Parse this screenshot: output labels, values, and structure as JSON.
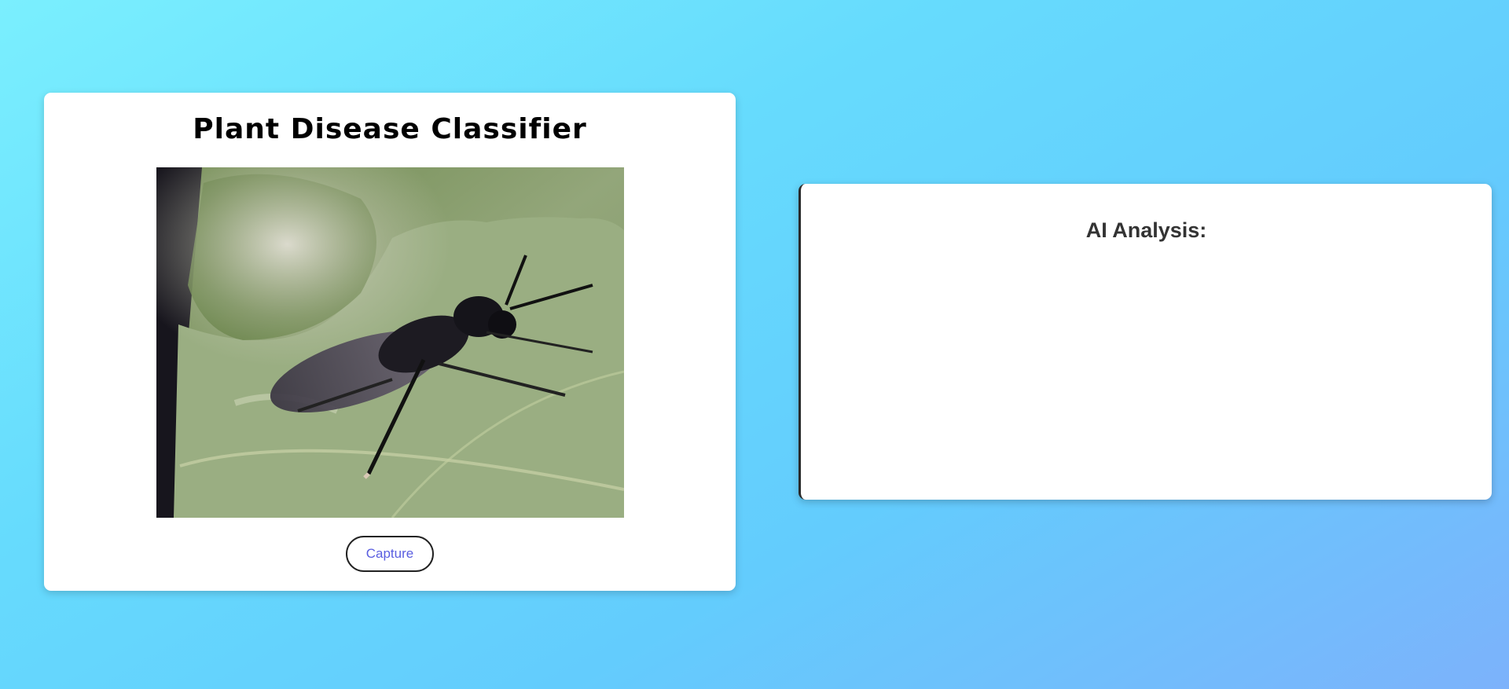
{
  "classifier": {
    "title": "Plant Disease Classifier",
    "camera_feed": {
      "description_icon": "camera-preview",
      "subject": "insect-on-leaf"
    },
    "capture_label": "Capture"
  },
  "analysis": {
    "heading": "AI Analysis:",
    "result": ""
  },
  "colors": {
    "background_start": "#7aeffe",
    "background_end": "#7cb2fb",
    "card": "#ffffff",
    "capture_text": "#5a5ee0",
    "heading_text": "#333333"
  }
}
